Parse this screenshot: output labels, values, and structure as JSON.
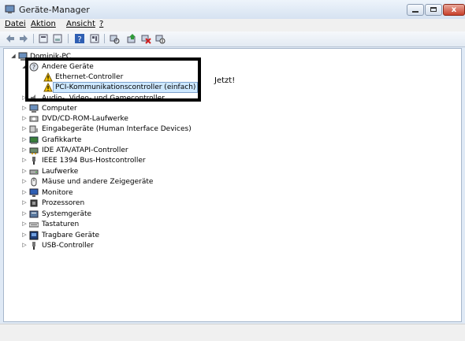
{
  "window": {
    "title": "Geräte-Manager",
    "close_glyph": "x"
  },
  "menu": [
    "Datei",
    "Aktion",
    "Ansicht",
    "?"
  ],
  "toolbar_icons": [
    "back-arrow-icon",
    "forward-arrow-icon",
    "properties-icon",
    "view-icon",
    "help-icon",
    "details-icon",
    "scan-hardware-icon",
    "update-driver-icon",
    "uninstall-icon",
    "disable-icon"
  ],
  "tree": {
    "root": "Dominik-PC",
    "andere_geraete": {
      "label": "Andere Geräte",
      "children": [
        "Ethernet-Controller",
        "PCI-Kommunikationscontroller (einfach)"
      ]
    },
    "categories": [
      "Audio-, Video- und Gamecontroller",
      "Computer",
      "DVD/CD-ROM-Laufwerke",
      "Eingabegeräte (Human Interface Devices)",
      "Grafikkarte",
      "IDE ATA/ATAPI-Controller",
      "IEEE 1394 Bus-Hostcontroller",
      "Laufwerke",
      "Mäuse und andere Zeigegeräte",
      "Monitore",
      "Prozessoren",
      "Systemgeräte",
      "Tastaturen",
      "Tragbare Geräte",
      "USB-Controller"
    ]
  },
  "annotation": "Jetzt!",
  "colors": {
    "titlebar": "#d6e2f1",
    "selection": "#cde8ff",
    "warning": "#f2c200",
    "close": "#c8402b"
  }
}
